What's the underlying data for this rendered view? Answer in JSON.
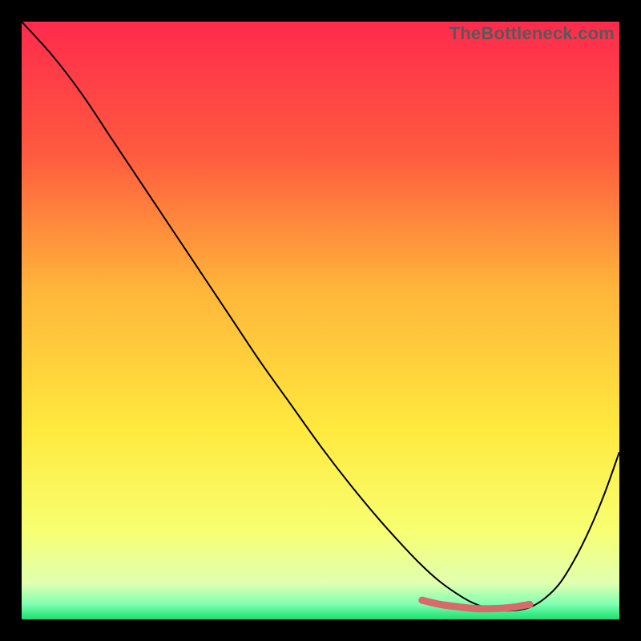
{
  "watermark": "TheBottleneck.com",
  "chart_data": {
    "type": "line",
    "title": "",
    "xlabel": "",
    "ylabel": "",
    "xlim": [
      0,
      100
    ],
    "ylim": [
      0,
      100
    ],
    "grid": false,
    "legend": false,
    "gradient": {
      "stops": [
        {
          "offset": 0,
          "color": "#ff2a4d"
        },
        {
          "offset": 0.22,
          "color": "#ff5a3f"
        },
        {
          "offset": 0.45,
          "color": "#ffb63a"
        },
        {
          "offset": 0.68,
          "color": "#ffe93e"
        },
        {
          "offset": 0.85,
          "color": "#f8ff70"
        },
        {
          "offset": 0.94,
          "color": "#e0ffb0"
        },
        {
          "offset": 0.975,
          "color": "#7fffb0"
        },
        {
          "offset": 1.0,
          "color": "#18e070"
        }
      ]
    },
    "series": [
      {
        "name": "bottleneck-curve",
        "x": [
          0.0,
          5,
          10,
          15,
          20,
          25,
          30,
          35,
          40,
          45,
          50,
          55,
          60,
          65,
          67.5,
          70,
          72.5,
          75,
          77.5,
          80,
          82.5,
          85,
          87.5,
          90,
          92.5,
          95,
          97.5,
          100
        ],
        "y": [
          100,
          94.5,
          88,
          80.5,
          73,
          65.5,
          58,
          50.5,
          43,
          36,
          29,
          22.5,
          16.5,
          11,
          8.5,
          6.3,
          4.5,
          3.0,
          2.0,
          1.5,
          1.5,
          2.0,
          3.5,
          6.0,
          10.0,
          15.0,
          21.0,
          28.0
        ]
      }
    ],
    "markers": {
      "name": "optimal-range",
      "x": [
        67,
        70,
        73,
        76,
        79,
        82,
        85
      ],
      "y": [
        3.2,
        2.5,
        2.1,
        1.8,
        1.8,
        2.0,
        2.5
      ]
    },
    "annotations": []
  }
}
